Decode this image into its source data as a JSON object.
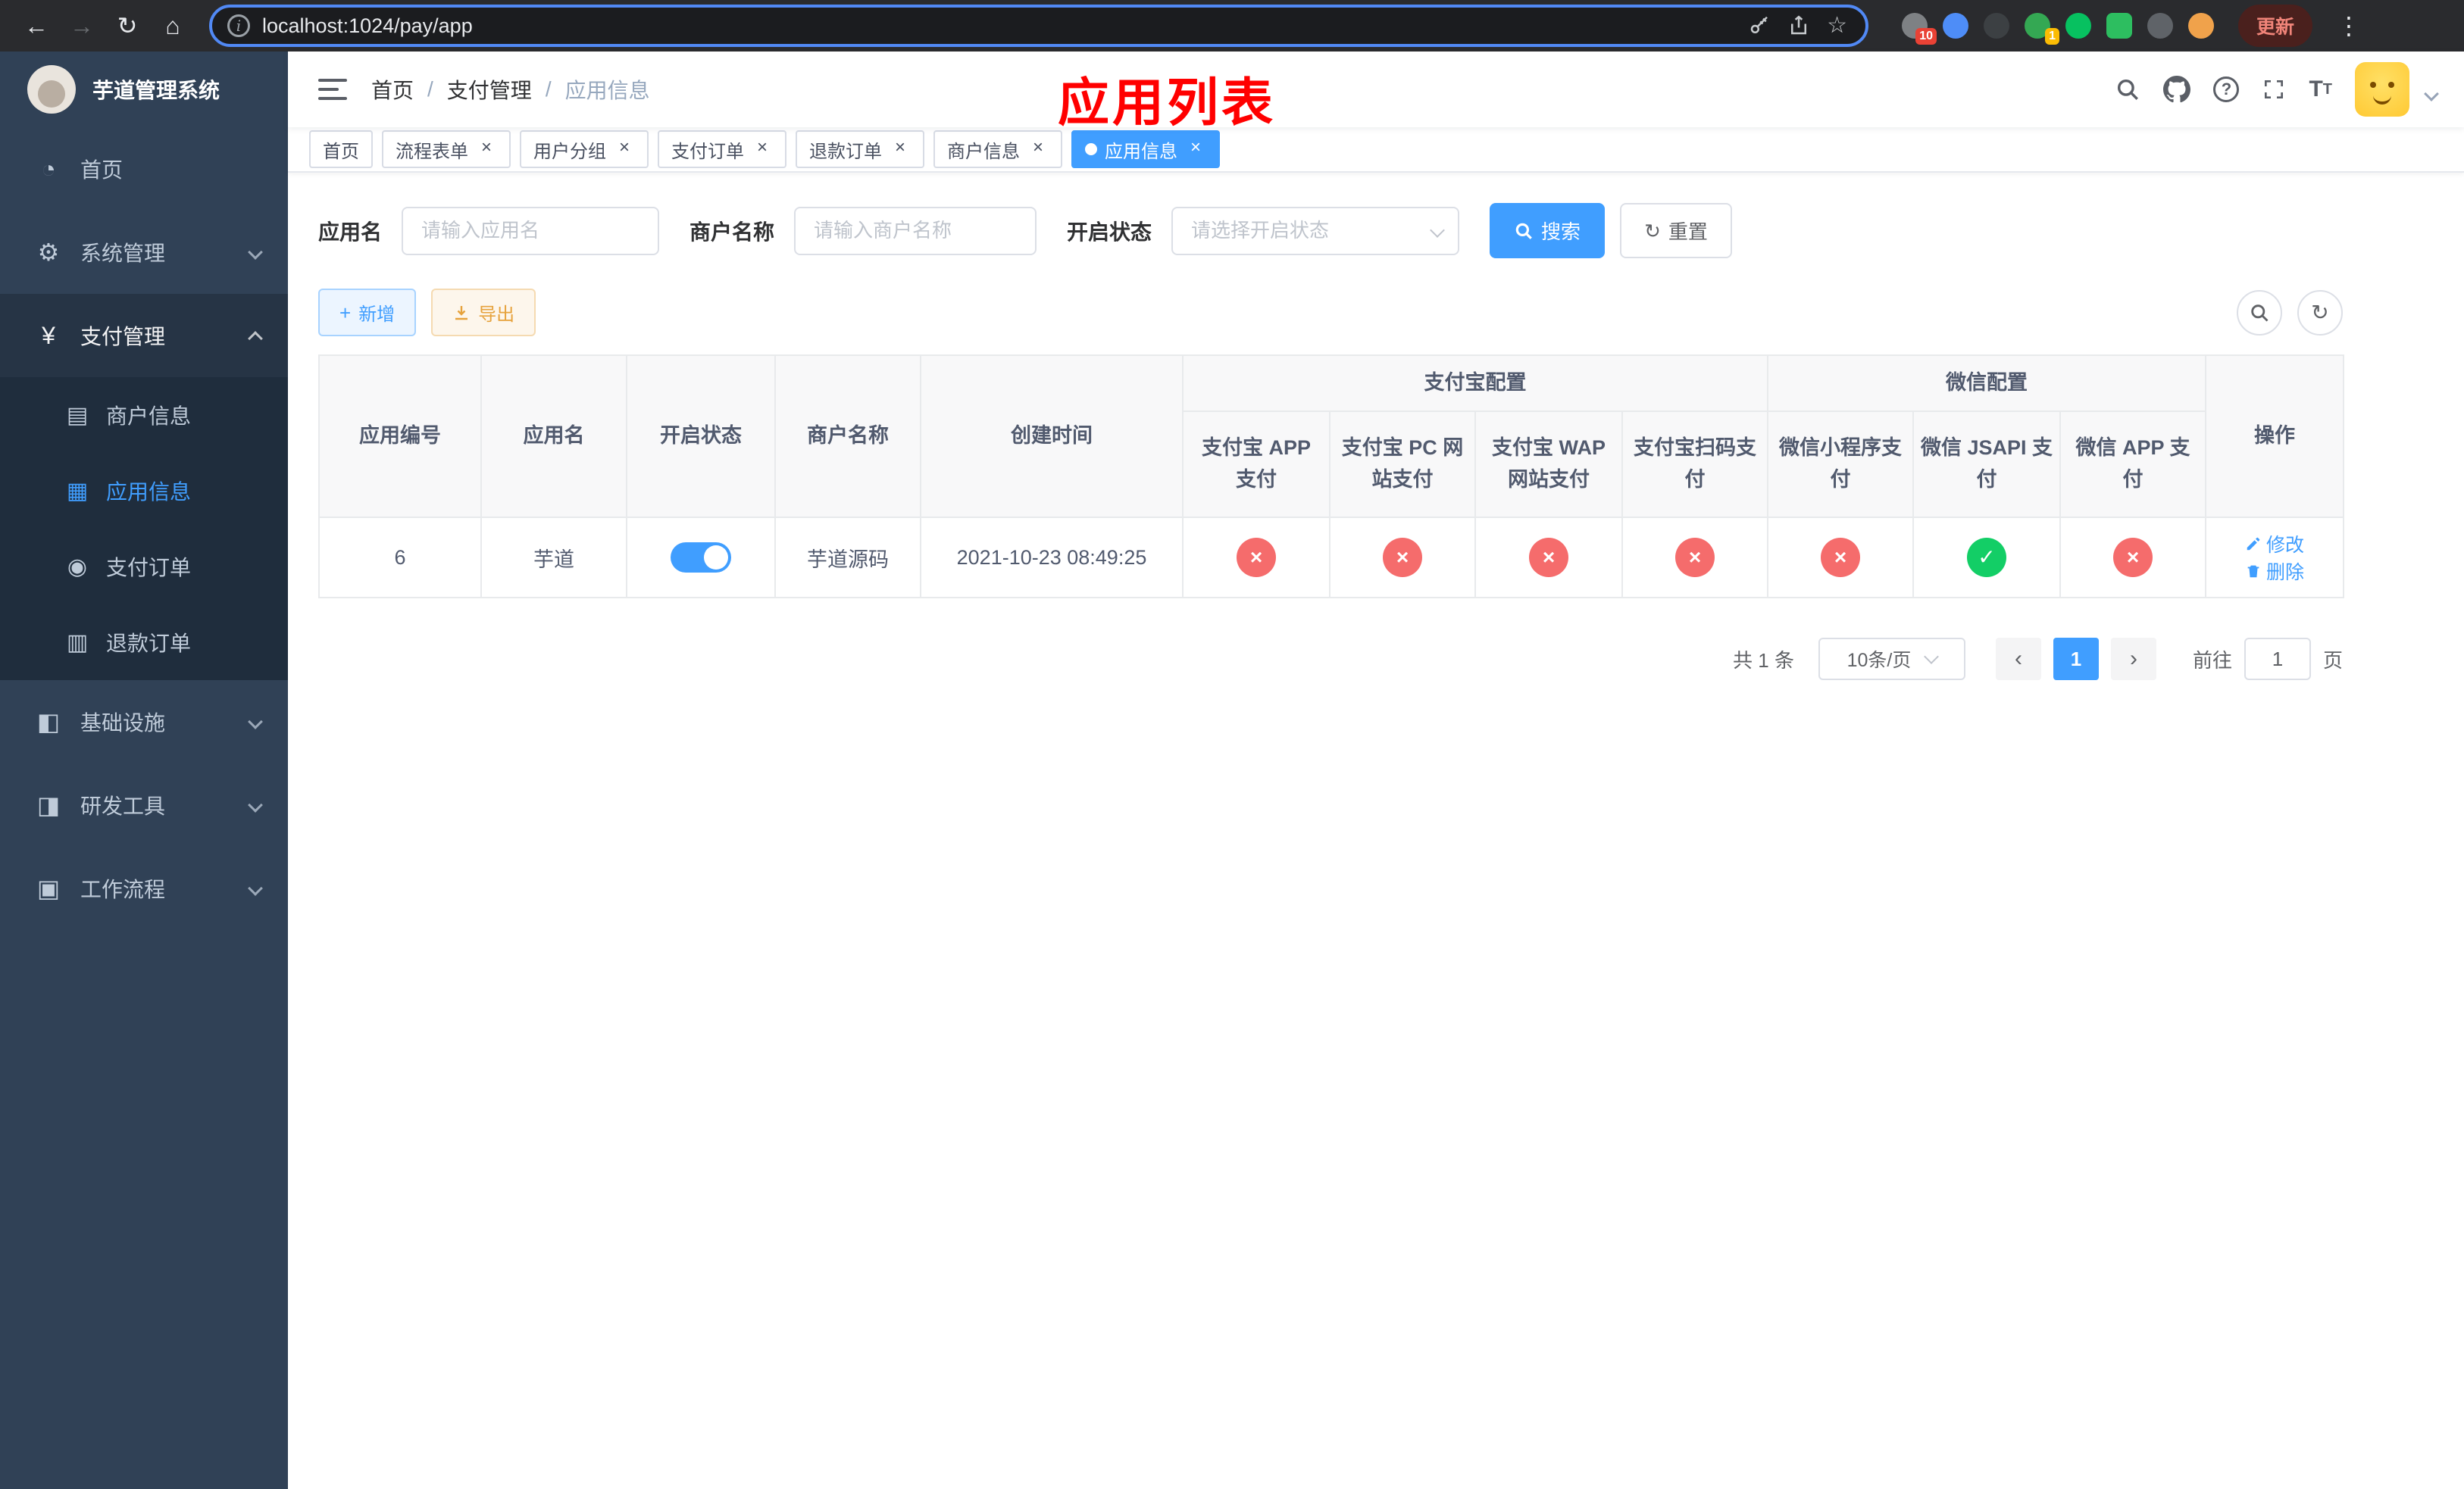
{
  "browser": {
    "url": "localhost:1024/pay/app",
    "update_label": "更新",
    "nav_icons": {
      "back": "←",
      "forward": "→",
      "reload": "↻",
      "home": "⌂",
      "info": "i",
      "star": "☆",
      "dots": "⋮"
    },
    "extensions": [
      {
        "name": "extension-puzzle",
        "color": "#7e8184",
        "badge": "10",
        "badge_color": "#e94235",
        "shape": "circle"
      },
      {
        "name": "extension-pin",
        "color": "#4e8df7",
        "shape": "circle"
      },
      {
        "name": "extension-dark-circle",
        "color": "#3c4043",
        "shape": "circle"
      },
      {
        "name": "extension-green-badge",
        "color": "#34a853",
        "badge": "1",
        "badge_color": "#fbbc04",
        "shape": "circle"
      },
      {
        "name": "extension-wechat",
        "color": "#07c160",
        "shape": "circle"
      },
      {
        "name": "extension-green-square",
        "color": "#2dbe60",
        "shape": "square"
      },
      {
        "name": "extension-puzzle-dark",
        "color": "#5f6368",
        "shape": "circle"
      },
      {
        "name": "extension-face",
        "color": "#f0a24b",
        "shape": "circle"
      }
    ]
  },
  "sidebar": {
    "title": "芋道管理系统",
    "items": [
      {
        "id": "home",
        "label": "首页",
        "icon": "dashboard",
        "glyph": "◔"
      },
      {
        "id": "system",
        "label": "系统管理",
        "icon": "gear",
        "glyph": "⚙",
        "expandable": true
      },
      {
        "id": "payment",
        "label": "支付管理",
        "icon": "yen",
        "glyph": "¥",
        "expandable": true,
        "expanded": true,
        "active_parent": true,
        "children": [
          {
            "id": "merchant-info",
            "label": "商户信息",
            "icon": "bank-card",
            "glyph": "▤"
          },
          {
            "id": "app-info",
            "label": "应用信息",
            "icon": "app-grid",
            "glyph": "▦",
            "active": true
          },
          {
            "id": "pay-order",
            "label": "支付订单",
            "icon": "coin",
            "glyph": "◉"
          },
          {
            "id": "refund-order",
            "label": "退款订单",
            "icon": "document",
            "glyph": "▥"
          }
        ]
      },
      {
        "id": "infrastructure",
        "label": "基础设施",
        "icon": "monitor",
        "glyph": "◧",
        "expandable": true
      },
      {
        "id": "dev-tools",
        "label": "研发工具",
        "icon": "toolbox",
        "glyph": "◨",
        "expandable": true
      },
      {
        "id": "workflow",
        "label": "工作流程",
        "icon": "workflow-box",
        "glyph": "▣",
        "expandable": true
      }
    ]
  },
  "header": {
    "breadcrumb": [
      "首页",
      "支付管理",
      "应用信息"
    ],
    "separator": "/",
    "annotation": "应用列表",
    "font_size_glyph": "T",
    "help_glyph": "?"
  },
  "tabs": [
    {
      "id": "home",
      "label": "首页",
      "closable": false
    },
    {
      "id": "flow-form",
      "label": "流程表单",
      "closable": true
    },
    {
      "id": "user-group",
      "label": "用户分组",
      "closable": true
    },
    {
      "id": "pay-order",
      "label": "支付订单",
      "closable": true
    },
    {
      "id": "refund-order",
      "label": "退款订单",
      "closable": true
    },
    {
      "id": "merchant-info",
      "label": "商户信息",
      "closable": true
    },
    {
      "id": "app-info",
      "label": "应用信息",
      "closable": true,
      "active": true
    }
  ],
  "filters": {
    "app_name_label": "应用名",
    "app_name_placeholder": "请输入应用名",
    "merchant_label": "商户名称",
    "merchant_placeholder": "请输入商户名称",
    "status_label": "开启状态",
    "status_placeholder": "请选择开启状态",
    "search_button": "搜索",
    "reset_button": "重置",
    "reset_icon_glyph": "↻"
  },
  "toolbar": {
    "add_button": "新增",
    "add_icon_glyph": "+",
    "export_button": "导出",
    "refresh_icon_glyph": "↻"
  },
  "table": {
    "group_headers": {
      "alipay": "支付宝配置",
      "wechat": "微信配置"
    },
    "columns": [
      "应用编号",
      "应用名",
      "开启状态",
      "商户名称",
      "创建时间",
      "支付宝 APP 支付",
      "支付宝 PC 网站支付",
      "支付宝 WAP 网站支付",
      "支付宝扫码支付",
      "微信小程序支付",
      "微信 JSAPI 支付",
      "微信 APP 支付",
      "操作"
    ],
    "status_glyphs": {
      "ok": "✓",
      "fail": "×"
    },
    "rows": [
      {
        "id": "6",
        "name": "芋道",
        "enabled": true,
        "merchant": "芋道源码",
        "created": "2021-10-23 08:49:25",
        "configs": [
          false,
          false,
          false,
          false,
          false,
          true,
          false
        ],
        "actions": [
          "修改",
          "删除"
        ]
      }
    ]
  },
  "pagination": {
    "total": "共 1 条",
    "page_size": "10条/页",
    "prev_glyph": "‹",
    "next_glyph": "›",
    "current_page": "1",
    "goto_label": "前往",
    "goto_value": "1",
    "page_suffix": "页"
  }
}
